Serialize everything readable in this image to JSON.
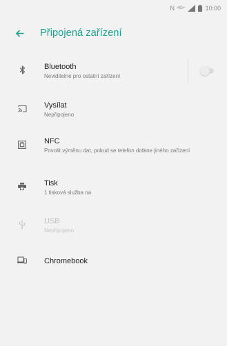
{
  "status_bar": {
    "network_label": "N",
    "data_badge": "4G+",
    "time": "10:00"
  },
  "header": {
    "title": "Připojená zařízení",
    "back_icon": "arrow-left-icon"
  },
  "items": [
    {
      "icon": "bluetooth-icon",
      "title": "Bluetooth",
      "subtitle": "Neviditelné pro ostatní zařízení",
      "toggle": {
        "enabled": false
      }
    },
    {
      "icon": "cast-icon",
      "title": "Vysílat",
      "subtitle": "Nepřipojeno"
    },
    {
      "icon": "nfc-icon",
      "title": "NFC",
      "subtitle": "Povolit výměnu dat, pokud se telefon dotkne jiného zařízení"
    },
    {
      "icon": "print-icon",
      "title": "Tisk",
      "subtitle": "1 tisková služba na"
    },
    {
      "icon": "usb-icon",
      "title": "USB",
      "subtitle": "Nepřipojeno",
      "disabled": true
    },
    {
      "icon": "chromebook-icon",
      "title": "Chromebook",
      "subtitle": ""
    }
  ],
  "colors": {
    "accent": "#18a38f",
    "background": "#f2f2f2",
    "icon": "#6d6d6d",
    "disabled": "#c0c0c0"
  }
}
